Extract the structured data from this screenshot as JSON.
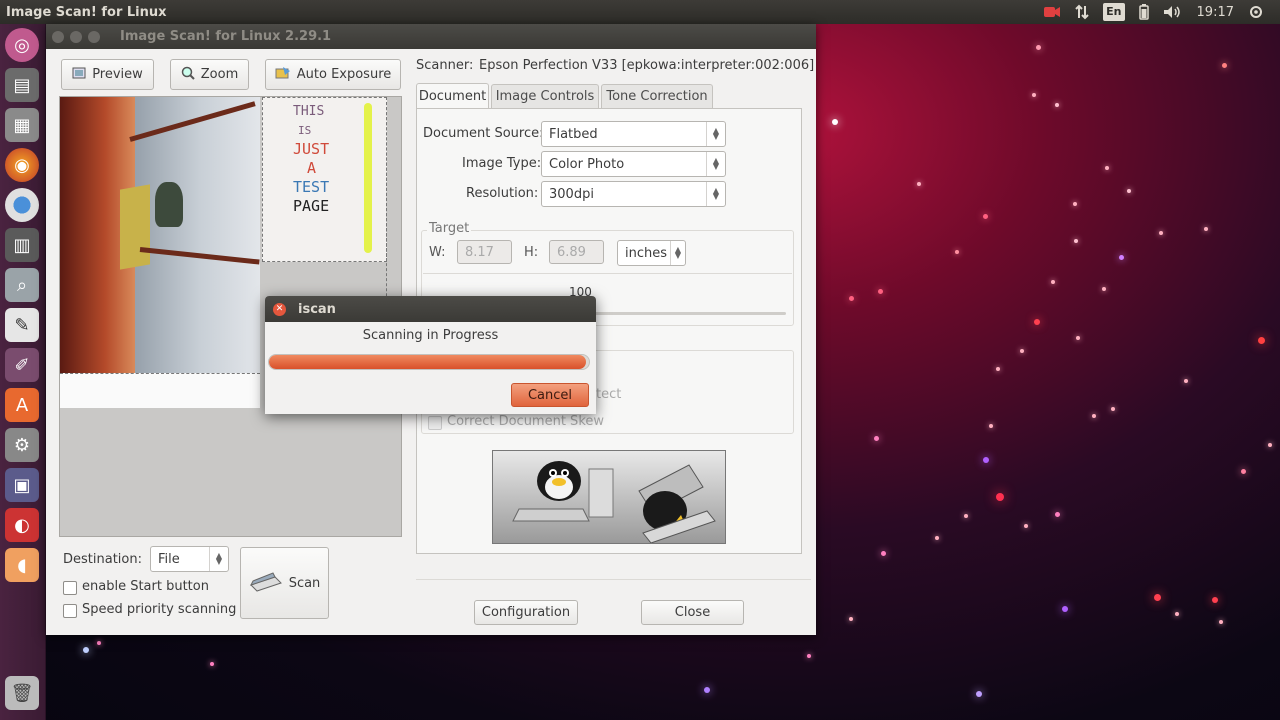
{
  "top_panel": {
    "app_title": "Image Scan! for Linux",
    "lang": "En",
    "clock": "19:17"
  },
  "window": {
    "title": "Image Scan! for Linux 2.29.1"
  },
  "toolbar": {
    "preview_label": "Preview",
    "zoom_label": "Zoom",
    "auto_exposure_label": "Auto Exposure"
  },
  "preview": {
    "page_text": [
      "THIS",
      "IS",
      "JUST",
      "A",
      "TEST",
      "PAGE"
    ]
  },
  "bottom_left": {
    "destination_label": "Destination:",
    "destination_value": "File",
    "enable_start_label": "enable Start button",
    "speed_priority_label": "Speed priority scanning",
    "scan_label": "Scan"
  },
  "scanner": {
    "label": "Scanner:",
    "value": "Epson Perfection V33 [epkowa:interpreter:002:006]"
  },
  "tabs": [
    {
      "label": "Document"
    },
    {
      "label": "Image Controls"
    },
    {
      "label": "Tone Correction"
    }
  ],
  "document": {
    "source_label": "Document Source:",
    "source_value": "Flatbed",
    "image_type_label": "Image Type:",
    "image_type_value": "Color Photo",
    "resolution_label": "Resolution:",
    "resolution_value": "300dpi",
    "target_label": "Target",
    "w_label": "W:",
    "w_value": "8.17",
    "h_label": "H:",
    "h_value": "6.89",
    "unit_value": "inches",
    "scale_value": "100",
    "autodetect_partial": "tect",
    "correct_skew_label": "Correct Document Skew"
  },
  "footer": {
    "configuration_label": "Configuration",
    "close_label": "Close"
  },
  "dialog": {
    "title": "iscan",
    "message": "Scanning in Progress",
    "progress": 0.99,
    "cancel_label": "Cancel"
  },
  "colors": {
    "accent": "#e0643c",
    "panel_bg": "#f2f1f0",
    "titlebar": "#3c3b37"
  }
}
